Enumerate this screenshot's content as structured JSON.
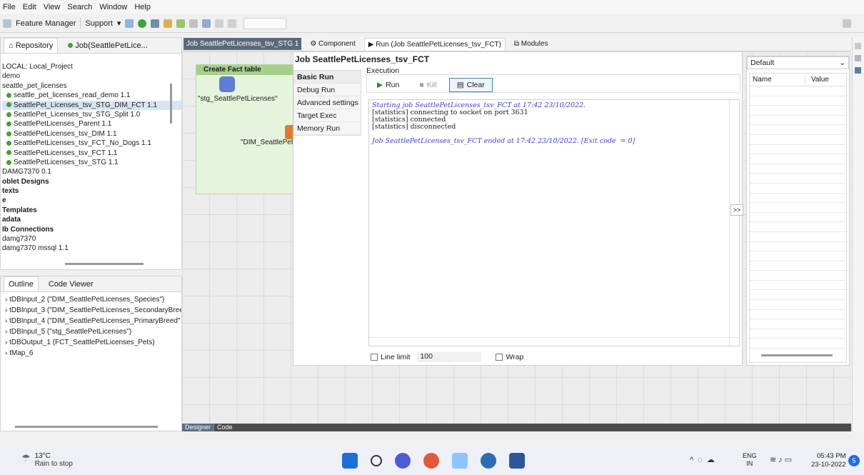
{
  "menu": [
    "File",
    "Edit",
    "View",
    "Search",
    "Window",
    "Help"
  ],
  "toolbar": {
    "feature_manager": "Feature Manager",
    "support": "Support"
  },
  "repo": {
    "tab_repository": "Repository",
    "tab_job": "Job(SeattlePetLice...",
    "items": [
      {
        "label": "LOCAL: Local_Project",
        "cls": ""
      },
      {
        "label": "demo",
        "cls": ""
      },
      {
        "label": "seattle_pet_licenses",
        "cls": ""
      },
      {
        "label": "seattle_pet_licenses_read_demo 1.1",
        "cls": "job"
      },
      {
        "label": "SeattlePet_Licenses_tsv_STG_DIM_FCT 1.1",
        "cls": "job sel"
      },
      {
        "label": "SeattlePet_Licenses_tsv_STG_Split 1.0",
        "cls": "job"
      },
      {
        "label": "SeattlePetLicenses_Parent 1.1",
        "cls": "job"
      },
      {
        "label": "SeattlePetLicenses_tsv_DIM 1.1",
        "cls": "job"
      },
      {
        "label": "SeattlePetLicenses_tsv_FCT_No_Dogs 1.1",
        "cls": "job"
      },
      {
        "label": "SeattlePetLicenses_tsv_FCT 1.1",
        "cls": "job"
      },
      {
        "label": "SeattlePetLicenses_tsv_STG 1.1",
        "cls": "job"
      },
      {
        "label": "DAMG7370 0.1",
        "cls": ""
      },
      {
        "label": "oblet Designs",
        "cls": "bold"
      },
      {
        "label": "texts",
        "cls": "bold"
      },
      {
        "label": "e",
        "cls": "bold"
      },
      {
        "label": "Templates",
        "cls": "bold"
      },
      {
        "label": "adata",
        "cls": "bold"
      },
      {
        "label": "Ib Connections",
        "cls": "bold"
      },
      {
        "label": "damg7370",
        "cls": ""
      },
      {
        "label": "damg7370 mssql 1.1",
        "cls": ""
      }
    ]
  },
  "outline": {
    "tab_outline": "Outline",
    "tab_code": "Code Viewer",
    "items": [
      "tDBInput_2 (\"DIM_SeattlePetLicenses_Species\")",
      "tDBInput_3 (\"DIM_SeattlePetLicenses_SecondaryBree",
      "tDBInput_4 (\"DIM_SeattlePetLicenses_PrimaryBreed\"",
      "tDBInput_5 (\"stg_SeattlePetLicenses\")",
      "tDBOutput_1 (FCT_SeattlePetLicenses_Pets)",
      "tMap_6"
    ]
  },
  "editor_tabs": {
    "job_stg": "Job SeattlePetLicenses_tsv_STG 1",
    "component": "Component",
    "run": "Run (Job SeattlePetLicenses_tsv_FCT)",
    "modules": "Modules"
  },
  "designer": {
    "subjob": "Create Fact table",
    "comp1": "\"stg_SeattlePetLicenses\"",
    "comp2": "\"DIM_SeattlePetL",
    "tab_designer": "Designer",
    "tab_code": "Code"
  },
  "run": {
    "title": "Job SeattlePetLicenses_tsv_FCT",
    "side": [
      "Basic Run",
      "Debug Run",
      "Advanced settings",
      "Target Exec",
      "Memory Run"
    ],
    "execution": "Execution",
    "run_btn": "Run",
    "kill_btn": "Kill",
    "clear_btn": "Clear",
    "console": [
      {
        "text": "Starting job SeattlePetLicenses_tsv_FCT at 17:42 23/10/2022.",
        "cls": "blue"
      },
      {
        "text": "[statistics] connecting to socket on port 3631",
        "cls": ""
      },
      {
        "text": "[statistics] connected",
        "cls": ""
      },
      {
        "text": "[statistics] disconnected",
        "cls": ""
      },
      {
        "text": " ",
        "cls": ""
      },
      {
        "text": "Job SeattlePetLicenses_tsv_FCT ended at 17:42 23/10/2022. [Exit code  = 0]",
        "cls": "blue"
      }
    ],
    "line_limit_label": "Line limit",
    "line_limit_value": "100",
    "wrap_label": "Wrap",
    "toggle": ">>"
  },
  "context": {
    "select": "Default",
    "col_name": "Name",
    "col_value": "Value"
  },
  "taskbar": {
    "temp": "13°C",
    "weather": "Rain to stop",
    "lang1": "ENG",
    "lang2": "IN",
    "time": "05:43 PM",
    "date": "23-10-2022",
    "badge": "5"
  }
}
